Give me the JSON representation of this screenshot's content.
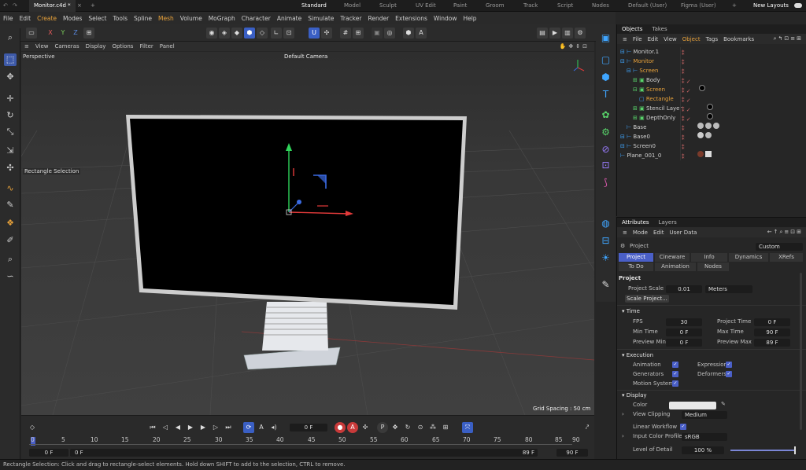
{
  "titlebar": {
    "doc_tab": "Monitor.c4d *",
    "layouts": [
      "Standard",
      "Model",
      "Sculpt",
      "UV Edit",
      "Paint",
      "Groom",
      "Track",
      "Script",
      "Nodes",
      "Default (User)",
      "Figma (User)"
    ],
    "new_layouts": "New Layouts"
  },
  "menu": [
    "File",
    "Edit",
    "Create",
    "Modes",
    "Select",
    "Tools",
    "Spline",
    "Mesh",
    "Volume",
    "MoGraph",
    "Character",
    "Animate",
    "Simulate",
    "Tracker",
    "Render",
    "Extensions",
    "Window",
    "Help"
  ],
  "toolbar": {
    "axes": [
      "X",
      "Y",
      "Z"
    ]
  },
  "viewport": {
    "menu": [
      "View",
      "Cameras",
      "Display",
      "Options",
      "Filter",
      "Panel"
    ],
    "mode": "Perspective",
    "camera": "Default Camera",
    "tool_label": "Rectangle Selection",
    "grid_spacing": "Grid Spacing : 50 cm"
  },
  "timeline": {
    "current_frame": "0 F",
    "ticks": [
      "0",
      "5",
      "10",
      "15",
      "20",
      "25",
      "30",
      "35",
      "40",
      "45",
      "50",
      "55",
      "60",
      "65",
      "70",
      "75",
      "80",
      "85",
      "90"
    ],
    "start": "0 F",
    "range_start": "0 F",
    "range_end": "89 F",
    "end": "90 F"
  },
  "status": "Rectangle Selection: Click and drag to rectangle-select elements. Hold down SHIFT to add to the selection, CTRL to remove.",
  "objects": {
    "tabs": [
      "Objects",
      "Takes"
    ],
    "menu": [
      "File",
      "Edit",
      "View",
      "Object",
      "Tags",
      "Bookmarks"
    ],
    "items": [
      "Monitor.1",
      "Monitor",
      "Screen",
      "Body",
      "Screen",
      "Rectangle",
      "Stencil Layer",
      "DepthOnly",
      "Base",
      "Base0",
      "Screen0",
      "Plane_001_0"
    ]
  },
  "attributes": {
    "tabs": [
      "Attributes",
      "Layers"
    ],
    "menu": [
      "Mode",
      "Edit",
      "User Data"
    ],
    "object_name": "Project",
    "preset": "Custom",
    "subtabs": [
      "Project",
      "Cineware",
      "Info",
      "Dynamics",
      "XRefs",
      "To Do",
      "Animation",
      "Nodes"
    ],
    "section_title": "Project",
    "project_scale_label": "Project Scale",
    "project_scale": "0.01",
    "project_unit": "Meters",
    "scale_button": "Scale Project...",
    "time_header": "Time",
    "fps_label": "FPS",
    "fps": "30",
    "project_time_label": "Project Time",
    "project_time": "0 F",
    "min_time_label": "Min Time",
    "min_time": "0 F",
    "max_time_label": "Max Time",
    "max_time": "90 F",
    "preview_min_label": "Preview Min",
    "preview_min": "0 F",
    "preview_max_label": "Preview Max",
    "preview_max": "89 F",
    "execution_header": "Execution",
    "animation_label": "Animation",
    "expression_label": "Expression",
    "generators_label": "Generators",
    "deformers_label": "Deformers",
    "motion_system_label": "Motion System",
    "display_header": "Display",
    "color_label": "Color",
    "view_clipping_label": "View Clipping",
    "view_clipping": "Medium",
    "linear_workflow_label": "Linear Workflow",
    "input_color_profile_label": "Input Color Profile",
    "input_color_profile": "sRGB",
    "level_of_detail_label": "Level of Detail",
    "level_of_detail": "100 %",
    "level_of_detail_fraction": 1.0
  },
  "colors": {
    "accent": "#3a5fc4",
    "selected_orange": "#e7a13a",
    "icon_blue": "#3fa5ff"
  }
}
